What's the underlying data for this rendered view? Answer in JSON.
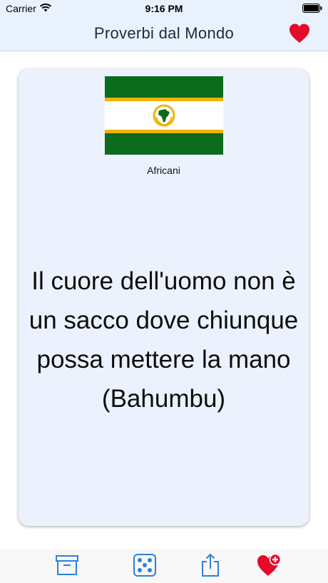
{
  "status_bar": {
    "carrier": "Carrier",
    "time": "9:16 PM"
  },
  "nav": {
    "title": "Proverbi dal Mondo",
    "favorites_icon": "heart-icon"
  },
  "card": {
    "flag_icon": "african-union-flag",
    "region": "Africani",
    "proverb": "Il cuore dell'uomo non è un sacco dove chiunque possa mettere la mano (Bahumbu)"
  },
  "toolbar": {
    "items": [
      {
        "icon": "archive-box-icon"
      },
      {
        "icon": "dice-icon"
      },
      {
        "icon": "share-icon"
      },
      {
        "icon": "heart-add-icon"
      }
    ]
  },
  "colors": {
    "accent_blue": "#2f80d8",
    "heart_red": "#e5092a",
    "flag_green": "#0b6b1c",
    "flag_gold": "#f0b400",
    "nav_background": "#e9f1fc",
    "card_background": "#ecf2fd"
  }
}
